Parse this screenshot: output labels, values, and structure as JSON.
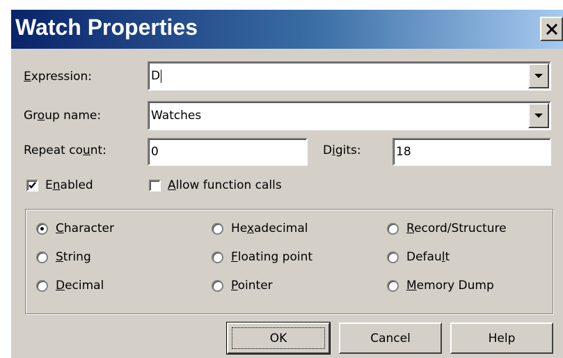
{
  "dialog": {
    "title": "Watch Properties",
    "close_glyph": "✕"
  },
  "expression": {
    "label_prefix": "",
    "label_key": "E",
    "label_rest": "xpression:",
    "value": "D"
  },
  "group_name": {
    "label_prefix": "Gr",
    "label_key": "o",
    "label_rest": "up name:",
    "value": "Watches"
  },
  "repeat_count": {
    "label_prefix": "Repeat co",
    "label_key": "u",
    "label_rest": "nt:",
    "value": "0"
  },
  "digits": {
    "label_prefix": "D",
    "label_key": "i",
    "label_rest": "gits:",
    "value": "18"
  },
  "enabled": {
    "label_prefix": "E",
    "label_key": "n",
    "label_rest": "abled",
    "checked": true
  },
  "allow_function_calls": {
    "label_prefix": "",
    "label_key": "A",
    "label_rest": "llow function calls",
    "checked": false
  },
  "display_format": {
    "options": [
      {
        "prefix": "",
        "key": "C",
        "rest": "haracter",
        "selected": true
      },
      {
        "prefix": "He",
        "key": "x",
        "rest": "adecimal",
        "selected": false
      },
      {
        "prefix": "",
        "key": "R",
        "rest": "ecord/Structure",
        "selected": false
      },
      {
        "prefix": "",
        "key": "S",
        "rest": "tring",
        "selected": false
      },
      {
        "prefix": "",
        "key": "F",
        "rest": "loating point",
        "selected": false
      },
      {
        "prefix": "Defau",
        "key": "l",
        "rest": "t",
        "selected": false
      },
      {
        "prefix": "",
        "key": "D",
        "rest": "ecimal",
        "selected": false
      },
      {
        "prefix": "",
        "key": "P",
        "rest": "ointer",
        "selected": false
      },
      {
        "prefix": "",
        "key": "M",
        "rest": "emory Dump",
        "selected": false
      }
    ]
  },
  "buttons": {
    "ok": "OK",
    "cancel": "Cancel",
    "help": "Help"
  }
}
